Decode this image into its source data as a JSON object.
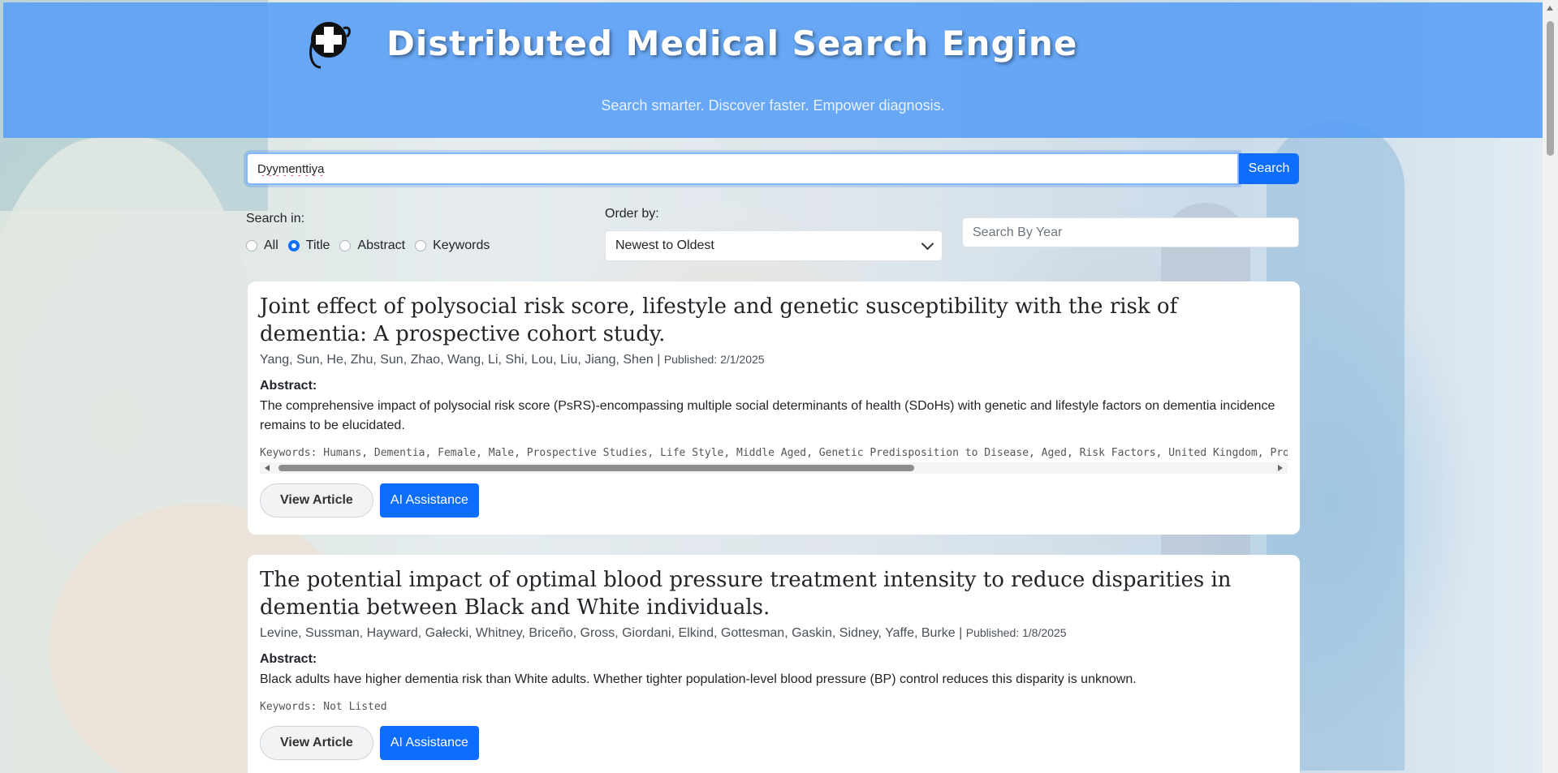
{
  "header": {
    "title": "Distributed Medical Search Engine",
    "tagline": "Search smarter. Discover faster. Empower diagnosis.",
    "logo_icon": "medical-cross-stethoscope-icon"
  },
  "search": {
    "value": "Dyymenttiya",
    "button_label": "Search"
  },
  "filters": {
    "search_in_label": "Search in:",
    "search_in_options": [
      "All",
      "Title",
      "Abstract",
      "Keywords"
    ],
    "search_in_selected": "Title",
    "order_by_label": "Order by:",
    "order_by_value": "Newest to Oldest",
    "year_placeholder": "Search By Year"
  },
  "results": [
    {
      "title": "Joint effect of polysocial risk score, lifestyle and genetic susceptibility with the risk of dementia: A prospective cohort study.",
      "authors": "Yang, Sun, He, Zhu, Sun, Zhao, Wang, Li, Shi, Lou, Liu, Jiang, Shen",
      "published": "Published: 2/1/2025",
      "abstract_label": "Abstract:",
      "abstract": "The comprehensive impact of polysocial risk score (PsRS)-encompassing multiple social determinants of health (SDoHs) with genetic and lifestyle factors on dementia incidence remains to be elucidated.",
      "keywords": "Keywords: Humans, Dementia, Female, Male, Prospective Studies, Life Style, Middle Aged, Genetic Predisposition to Disease, Aged, Risk Factors, United Kingdom, Propor",
      "view_label": "View Article",
      "ai_label": "AI Assistance"
    },
    {
      "title": "The potential impact of optimal blood pressure treatment intensity to reduce disparities in dementia between Black and White individuals.",
      "authors": "Levine, Sussman, Hayward, Gałecki, Whitney, Briceño, Gross, Giordani, Elkind, Gottesman, Gaskin, Sidney, Yaffe, Burke",
      "published": "Published: 1/8/2025",
      "abstract_label": "Abstract:",
      "abstract": "Black adults have higher dementia risk than White adults. Whether tighter population-level blood pressure (BP) control reduces this disparity is unknown.",
      "keywords": "Keywords: Not Listed",
      "view_label": "View Article",
      "ai_label": "AI Assistance"
    }
  ],
  "colors": {
    "header_bg": "#5aa0f5",
    "primary": "#0d6efd"
  }
}
